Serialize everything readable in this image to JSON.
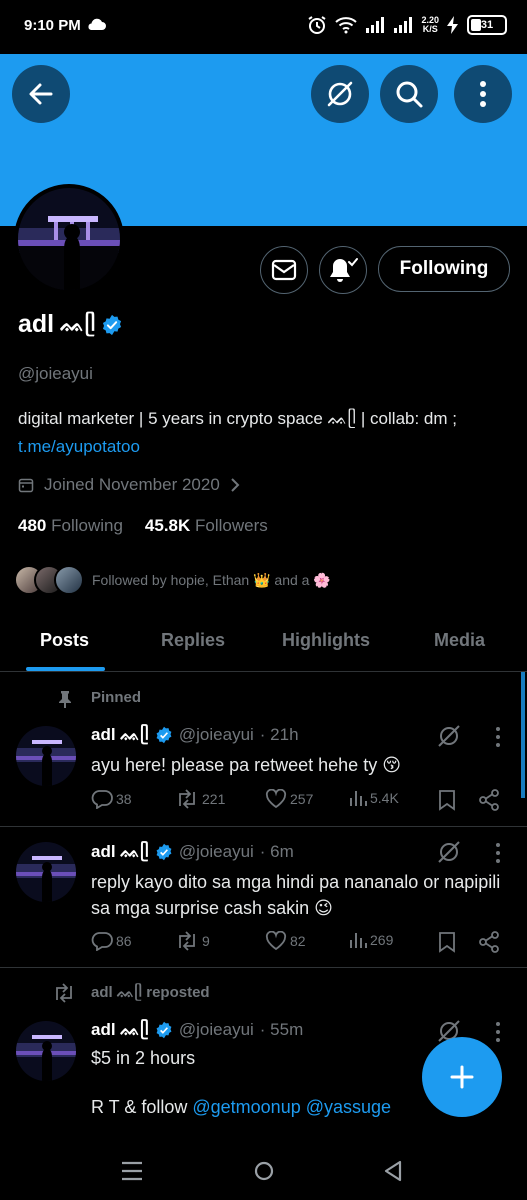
{
  "status_bar": {
    "time": "9:10 PM",
    "net_speed_value": "2.20",
    "net_speed_unit": "K/S",
    "battery_level": "31"
  },
  "header": {
    "back_icon": "arrow-left-icon",
    "grok_icon": "grok-icon",
    "search_icon": "search-icon",
    "more_icon": "more-vertical-icon",
    "banner_color": "#1d9bf0"
  },
  "profile": {
    "name": "adl",
    "name_emoji": "ᨐᥫ",
    "handle": "@joieayui",
    "bio_text": "digital marketer | 5 years in crypto space ᨐᥫ | collab: dm ;",
    "bio_link": "t.me/ayupotatoo",
    "joined": "Joined November 2020",
    "following_count": "480",
    "following_label": "Following",
    "followers_count": "45.8K",
    "followers_label": "Followers",
    "followed_by_text": "Followed by hopie, Ethan 👑 and a 🌸",
    "following_button": "Following",
    "accent_color": "#1d9bf0"
  },
  "tabs": [
    {
      "label": "Posts",
      "active": true
    },
    {
      "label": "Replies",
      "active": false
    },
    {
      "label": "Highlights",
      "active": false
    },
    {
      "label": "Media",
      "active": false
    }
  ],
  "posts": [
    {
      "context": "Pinned",
      "name": "adl ᨐᥫ",
      "handle": "@joieayui",
      "time": "· 21h",
      "text": "ayu here! please pa retweet hehe ty 😚",
      "replies": "38",
      "reposts": "221",
      "likes": "257",
      "views": "5.4K"
    },
    {
      "context": "",
      "name": "adl ᨐᥫ",
      "handle": "@joieayui",
      "time": "· 6m",
      "text": "reply kayo dito sa mga hindi pa nananalo or napipili sa mga surprise cash sakin 😉",
      "replies": "86",
      "reposts": "9",
      "likes": "82",
      "views": "269"
    },
    {
      "context": "adl ᨐᥫ reposted",
      "name": "adl ᨐᥫ",
      "handle": "@joieayui",
      "time": "· 55m",
      "text": "$5 in 2 hours",
      "text2_prefix": "R T & follow ",
      "mention1": "@getmoonup",
      "mention2": "@yassuge"
    }
  ],
  "fab": {
    "icon": "plus-icon"
  },
  "nav": {
    "recents_icon": "menu-icon",
    "home_icon": "circle-icon",
    "back_icon": "triangle-back-icon"
  }
}
